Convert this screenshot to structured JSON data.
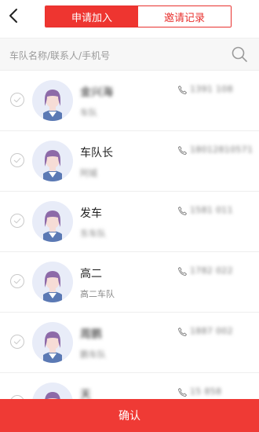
{
  "header": {
    "tabs": [
      {
        "label": "申请加入"
      },
      {
        "label": "邀请记录"
      }
    ]
  },
  "search": {
    "placeholder": "车队名称/联系人/手机号"
  },
  "members": [
    {
      "name": "金兴海",
      "team": "车队",
      "phone": "1391 108"
    },
    {
      "name": "车队长",
      "team": "阿城",
      "phone": "18012810571"
    },
    {
      "name": "发车",
      "team": "东车队",
      "phone": "1581 011"
    },
    {
      "name": "高二",
      "team": "高二车队",
      "phone": "1782 022"
    },
    {
      "name": "周鹏",
      "team": "鹏车队",
      "phone": "1887 002"
    },
    {
      "name": "天",
      "team": "",
      "phone": "15 858"
    }
  ],
  "footer": {
    "confirm_label": "确认"
  },
  "colors": {
    "accent": "#ee3530",
    "avatar_bg": "#e8ecf8"
  }
}
